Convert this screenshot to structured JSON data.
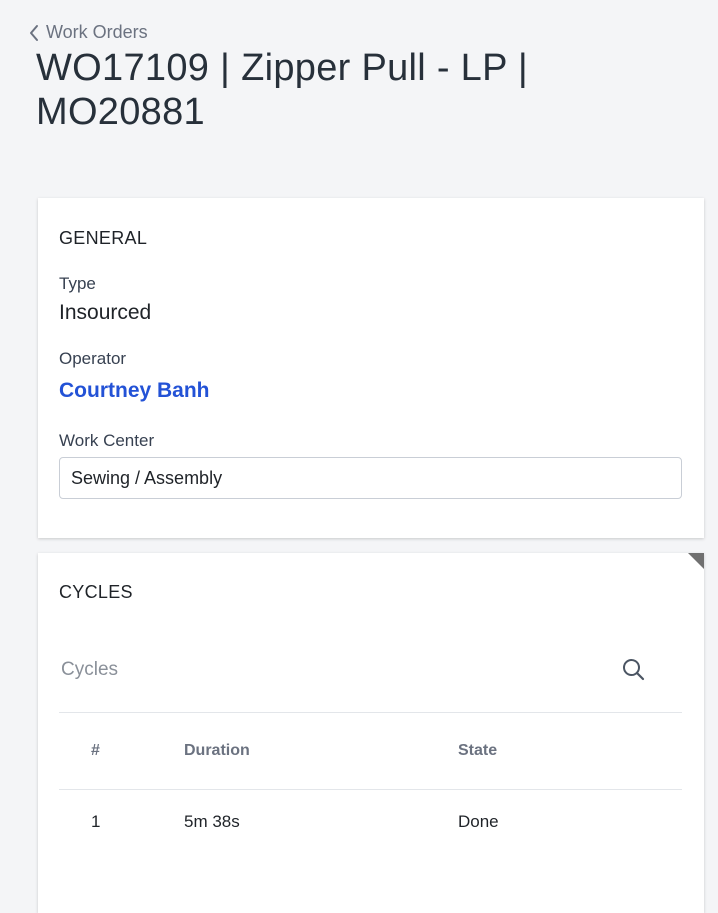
{
  "breadcrumb": {
    "label": "Work Orders"
  },
  "page": {
    "title": "WO17109 | Zipper Pull - LP | MO20881"
  },
  "general": {
    "section_title": "GENERAL",
    "type_label": "Type",
    "type_value": "Insourced",
    "operator_label": "Operator",
    "operator_value": "Courtney Banh",
    "work_center_label": "Work Center",
    "work_center_value": "Sewing / Assembly"
  },
  "cycles": {
    "section_title": "CYCLES",
    "search_placeholder": "Cycles",
    "columns": [
      "#",
      "Duration",
      "State"
    ],
    "rows": [
      {
        "num": "1",
        "duration": "5m 38s",
        "state": "Done"
      }
    ]
  },
  "colors": {
    "background": "#f4f5f7",
    "link": "#2352d6",
    "muted": "#6b7280"
  },
  "icons": {
    "back": "chevron-left-icon",
    "search": "search-icon"
  }
}
